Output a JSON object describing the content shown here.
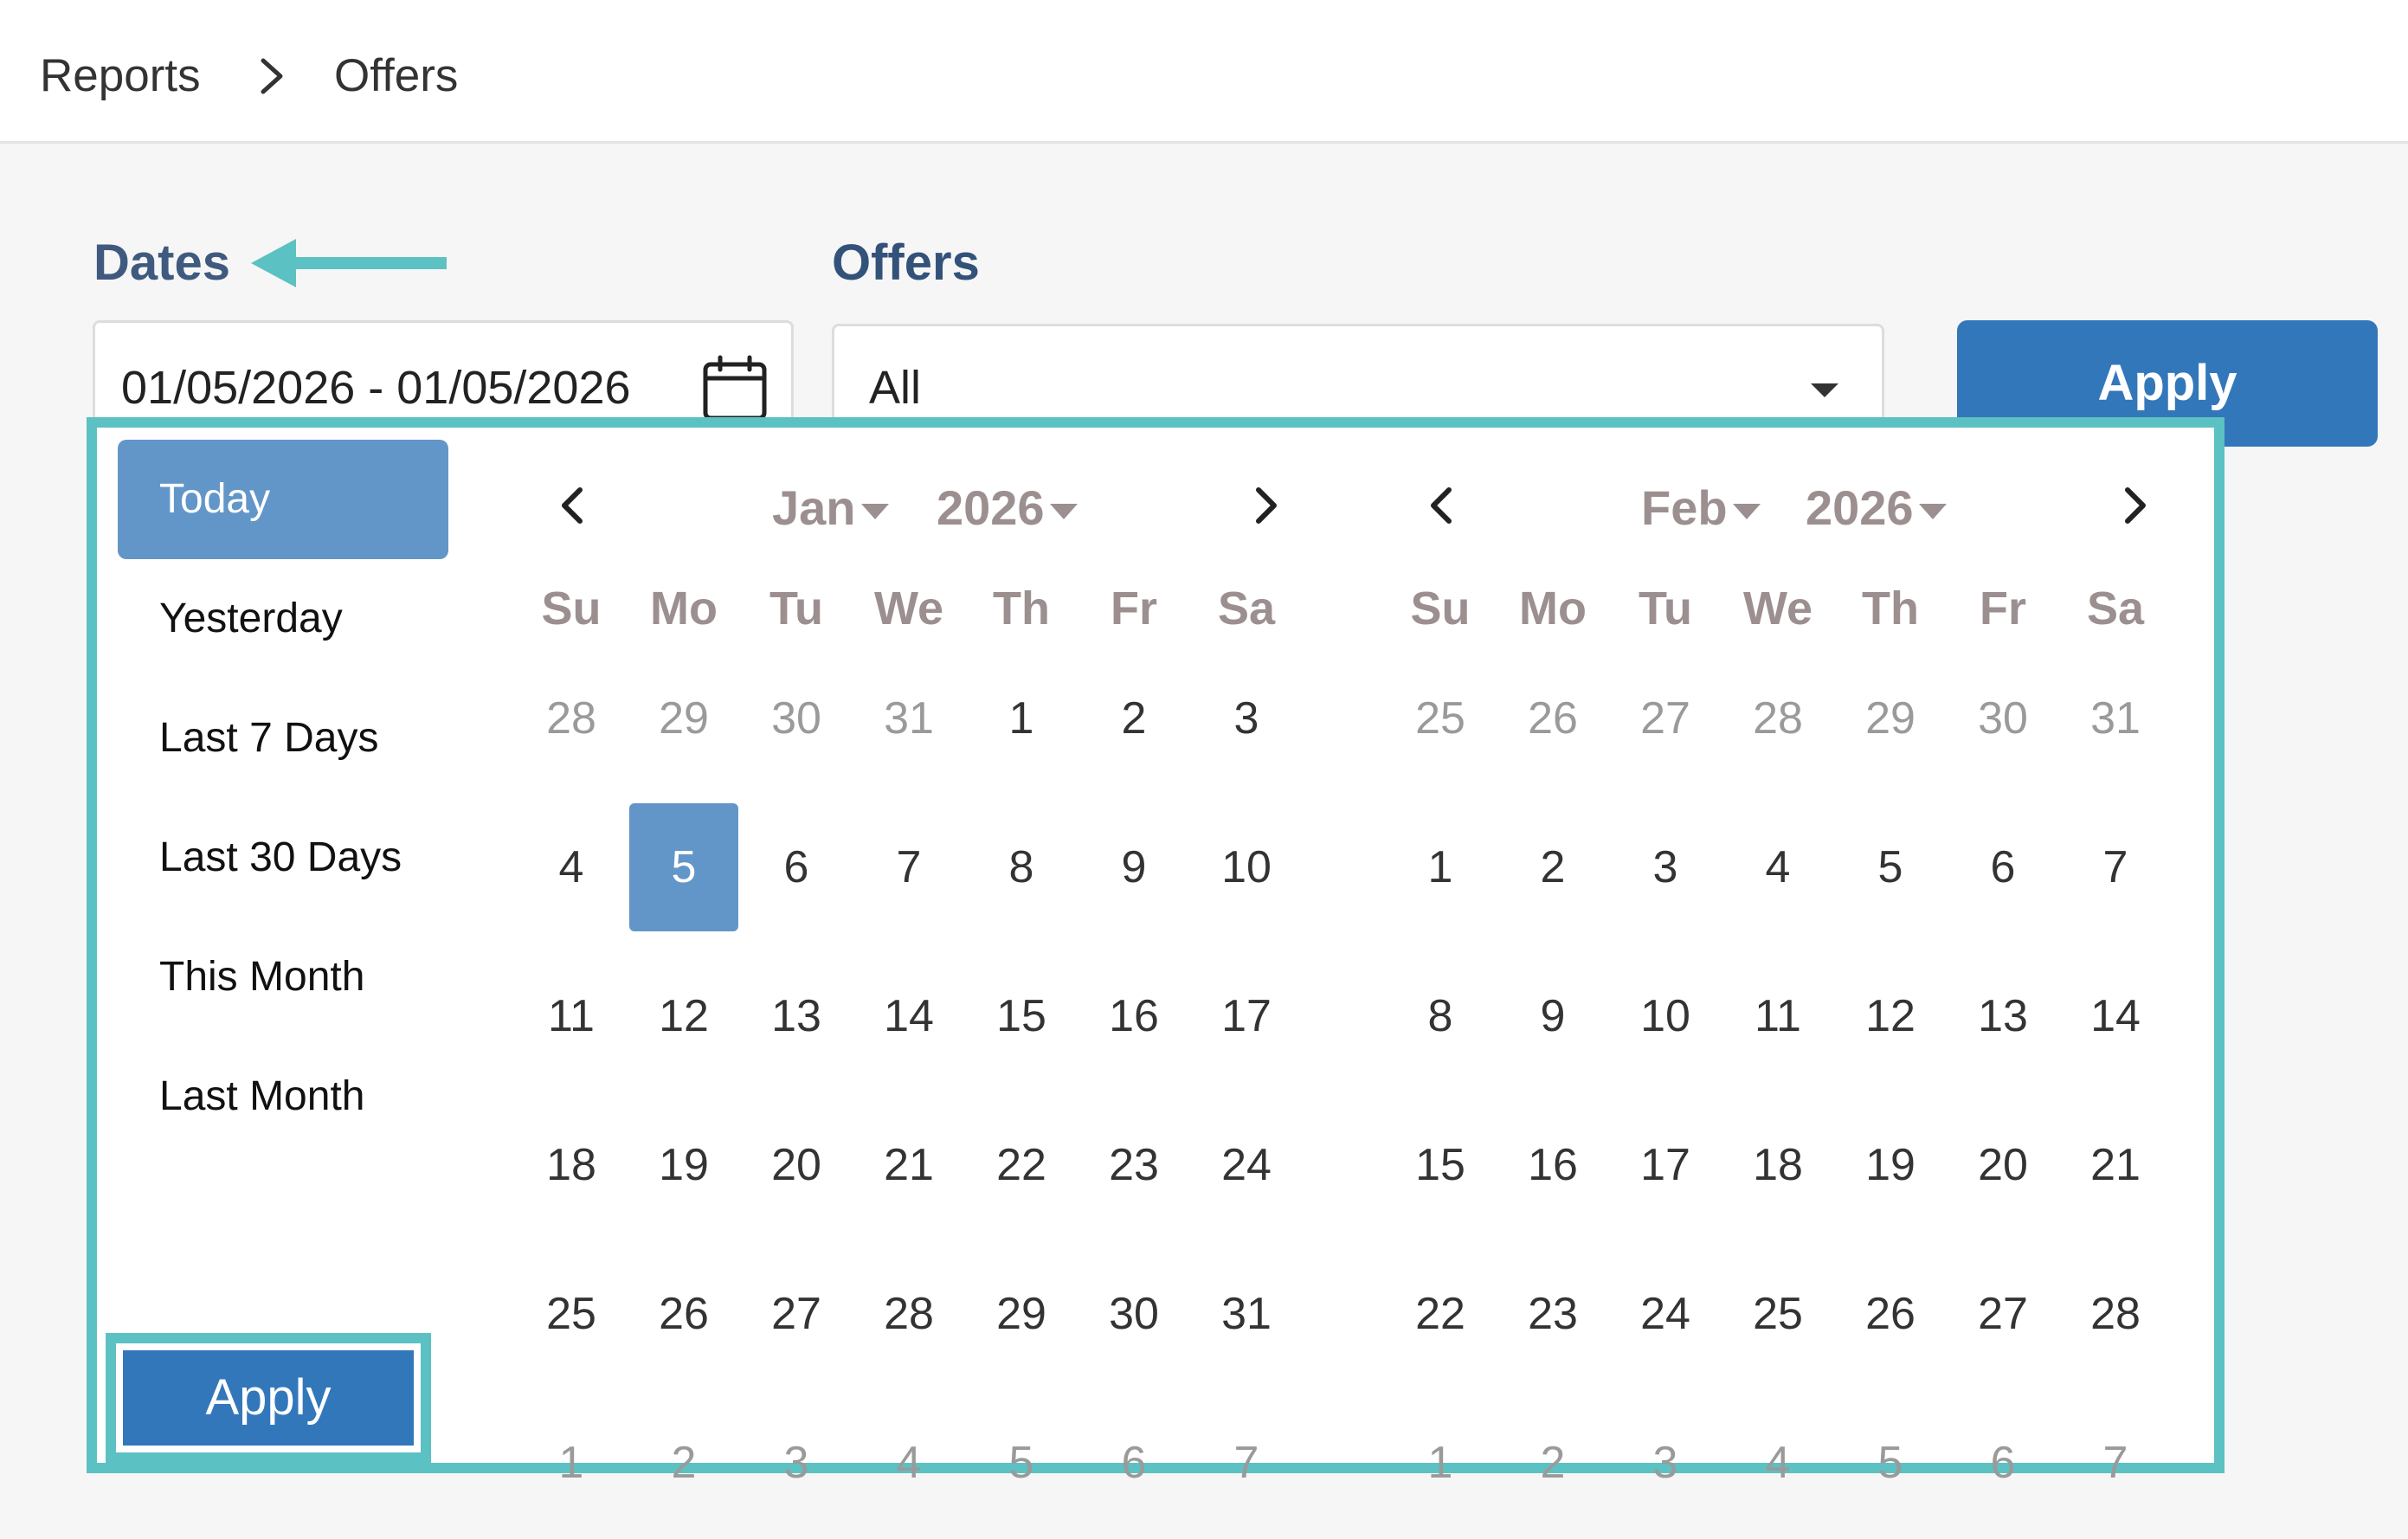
{
  "breadcrumb": {
    "items": [
      "Reports",
      "Offers"
    ]
  },
  "filters": {
    "dates_label": "Dates",
    "offers_label": "Offers",
    "date_range_value": "01/05/2026 - 01/05/2026",
    "offers_value": "All",
    "apply_label": "Apply"
  },
  "colors": {
    "accent": "#3377bb",
    "highlight": "#5cc1c2",
    "selected_day": "#6396c8"
  },
  "picker": {
    "ranges": [
      "Today",
      "Yesterday",
      "Last 7 Days",
      "Last 30 Days",
      "This Month",
      "Last Month"
    ],
    "active_range": "Today",
    "apply_label": "Apply",
    "weekdays": [
      "Su",
      "Mo",
      "Tu",
      "We",
      "Th",
      "Fr",
      "Sa"
    ],
    "calendars": [
      {
        "month": "Jan",
        "year": "2026",
        "weeks": [
          [
            {
              "d": "28",
              "off": true
            },
            {
              "d": "29",
              "off": true
            },
            {
              "d": "30",
              "off": true
            },
            {
              "d": "31",
              "off": true
            },
            {
              "d": "1"
            },
            {
              "d": "2"
            },
            {
              "d": "3"
            }
          ],
          [
            {
              "d": "4"
            },
            {
              "d": "5",
              "selected": true
            },
            {
              "d": "6"
            },
            {
              "d": "7"
            },
            {
              "d": "8"
            },
            {
              "d": "9"
            },
            {
              "d": "10"
            }
          ],
          [
            {
              "d": "11"
            },
            {
              "d": "12"
            },
            {
              "d": "13"
            },
            {
              "d": "14"
            },
            {
              "d": "15"
            },
            {
              "d": "16"
            },
            {
              "d": "17"
            }
          ],
          [
            {
              "d": "18"
            },
            {
              "d": "19"
            },
            {
              "d": "20"
            },
            {
              "d": "21"
            },
            {
              "d": "22"
            },
            {
              "d": "23"
            },
            {
              "d": "24"
            }
          ],
          [
            {
              "d": "25"
            },
            {
              "d": "26"
            },
            {
              "d": "27"
            },
            {
              "d": "28"
            },
            {
              "d": "29"
            },
            {
              "d": "30"
            },
            {
              "d": "31"
            }
          ],
          [
            {
              "d": "1",
              "off": true
            },
            {
              "d": "2",
              "off": true
            },
            {
              "d": "3",
              "off": true
            },
            {
              "d": "4",
              "off": true
            },
            {
              "d": "5",
              "off": true
            },
            {
              "d": "6",
              "off": true
            },
            {
              "d": "7",
              "off": true
            }
          ]
        ]
      },
      {
        "month": "Feb",
        "year": "2026",
        "weeks": [
          [
            {
              "d": "25",
              "off": true
            },
            {
              "d": "26",
              "off": true
            },
            {
              "d": "27",
              "off": true
            },
            {
              "d": "28",
              "off": true
            },
            {
              "d": "29",
              "off": true
            },
            {
              "d": "30",
              "off": true
            },
            {
              "d": "31",
              "off": true
            }
          ],
          [
            {
              "d": "1"
            },
            {
              "d": "2"
            },
            {
              "d": "3"
            },
            {
              "d": "4"
            },
            {
              "d": "5"
            },
            {
              "d": "6"
            },
            {
              "d": "7"
            }
          ],
          [
            {
              "d": "8"
            },
            {
              "d": "9"
            },
            {
              "d": "10"
            },
            {
              "d": "11"
            },
            {
              "d": "12"
            },
            {
              "d": "13"
            },
            {
              "d": "14"
            }
          ],
          [
            {
              "d": "15"
            },
            {
              "d": "16"
            },
            {
              "d": "17"
            },
            {
              "d": "18"
            },
            {
              "d": "19"
            },
            {
              "d": "20"
            },
            {
              "d": "21"
            }
          ],
          [
            {
              "d": "22"
            },
            {
              "d": "23"
            },
            {
              "d": "24"
            },
            {
              "d": "25"
            },
            {
              "d": "26"
            },
            {
              "d": "27"
            },
            {
              "d": "28"
            }
          ],
          [
            {
              "d": "1",
              "off": true
            },
            {
              "d": "2",
              "off": true
            },
            {
              "d": "3",
              "off": true
            },
            {
              "d": "4",
              "off": true
            },
            {
              "d": "5",
              "off": true
            },
            {
              "d": "6",
              "off": true
            },
            {
              "d": "7",
              "off": true
            }
          ]
        ]
      }
    ]
  }
}
